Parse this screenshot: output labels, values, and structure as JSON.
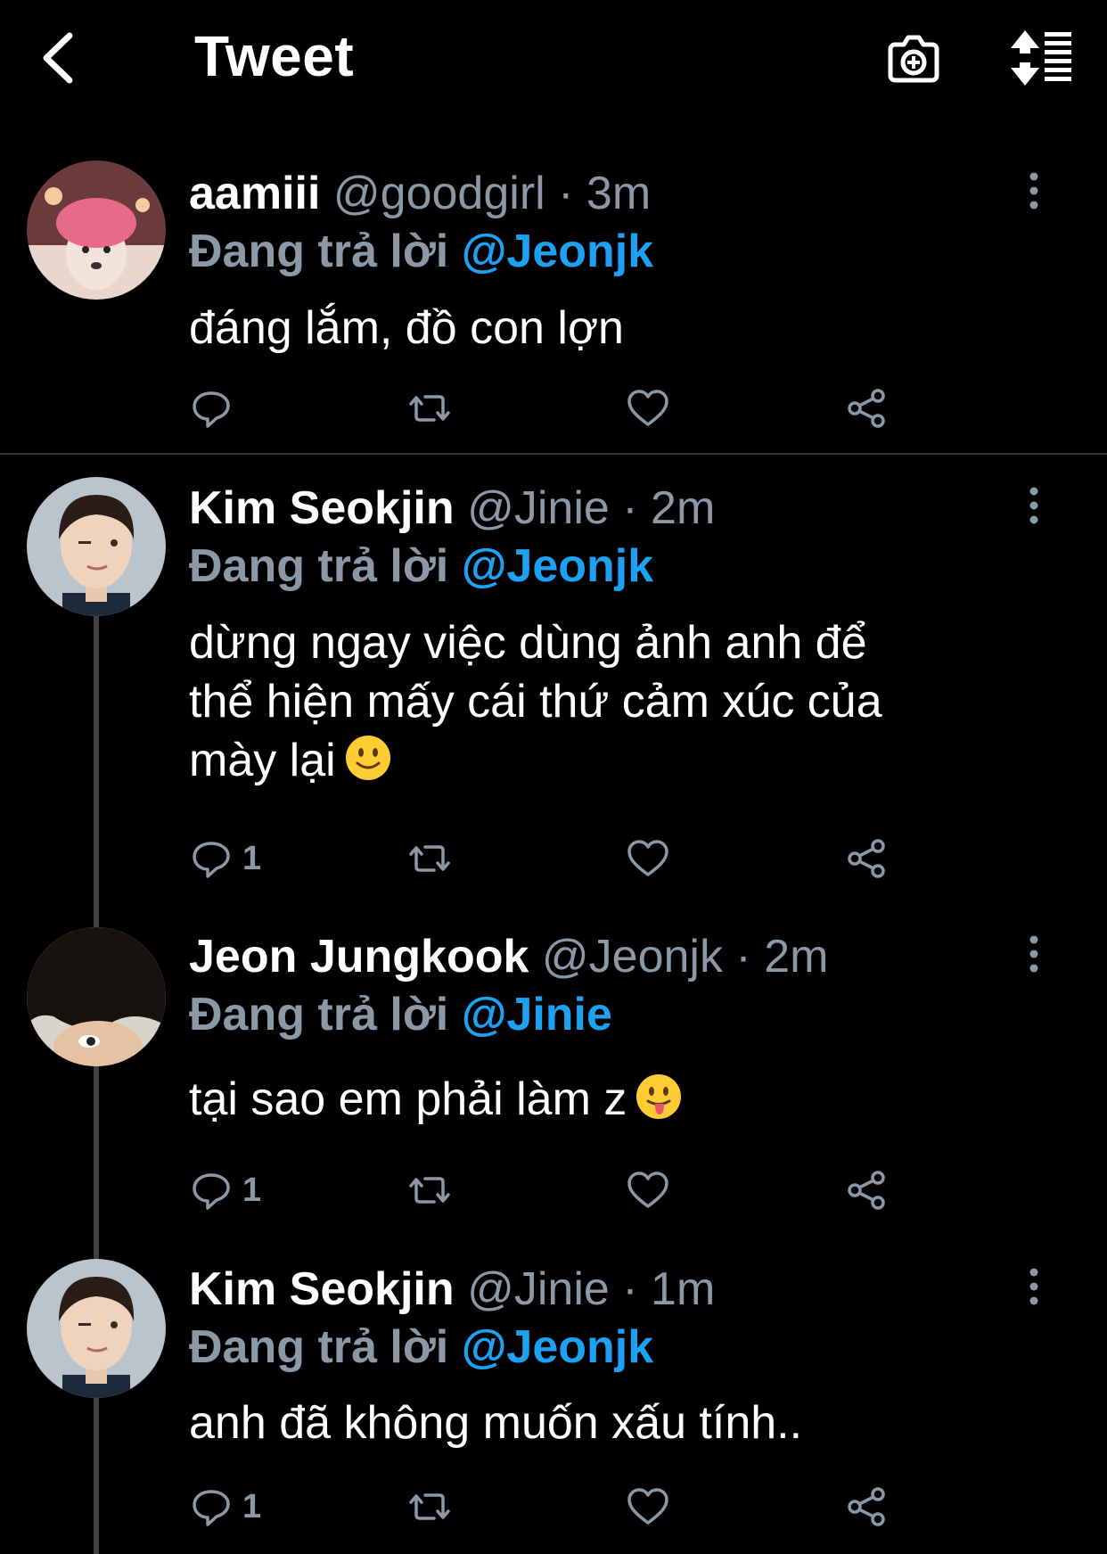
{
  "header": {
    "title": "Tweet"
  },
  "tweets": [
    {
      "name": "aamiii",
      "handle": "@goodgirl",
      "time": "3m",
      "reply_prefix": "Đang trả lời",
      "reply_to": "@Jeonjk",
      "text": "đáng lắm, đồ con lợn",
      "reply_count": ""
    },
    {
      "name": "Kim Seokjin",
      "handle": "@Jinie",
      "time": "2m",
      "reply_prefix": "Đang trả lời",
      "reply_to": "@Jeonjk",
      "text_lines": [
        "dừng ngay việc dùng ảnh anh để",
        "thể hiện mấy cái thứ cảm xúc của",
        "mày lại"
      ],
      "emoji": "slightly-smiling-face",
      "reply_count": "1"
    },
    {
      "name": "Jeon Jungkook",
      "handle": "@Jeonjk",
      "time": "2m",
      "reply_prefix": "Đang trả lời",
      "reply_to": "@Jinie",
      "text": "tại sao em phải làm z",
      "emoji": "face-with-tongue",
      "reply_count": "1"
    },
    {
      "name": "Kim Seokjin",
      "handle": "@Jinie",
      "time": "1m",
      "reply_prefix": "Đang trả lời",
      "reply_to": "@Jeonjk",
      "text": "anh đã không muốn xấu tính..",
      "reply_count": "1"
    }
  ],
  "colors": {
    "accent": "#1da1f2",
    "muted": "#8b98a5",
    "background": "#000000",
    "divider": "#2f3336"
  }
}
